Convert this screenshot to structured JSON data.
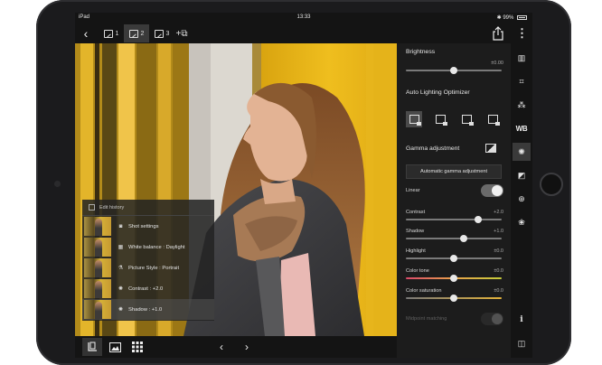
{
  "status": {
    "device": "iPad",
    "time": "13:33",
    "battery": "99%"
  },
  "tabs": [
    {
      "label": "1"
    },
    {
      "label": "2"
    },
    {
      "label": "3"
    }
  ],
  "history": {
    "title": "Edit history",
    "items": [
      {
        "label": "Shot settings",
        "icon": "camera-icon"
      },
      {
        "label": "White balance : Daylight",
        "icon": "white-balance-icon"
      },
      {
        "label": "Picture Style : Portrait",
        "icon": "picture-style-icon"
      },
      {
        "label": "Contrast : +2.0",
        "icon": "contrast-icon"
      },
      {
        "label": "Shadow : +1.0",
        "icon": "shadow-icon"
      }
    ]
  },
  "panel": {
    "brightness": {
      "title": "Brightness",
      "value": "±0.00",
      "level": 0.5
    },
    "alo": {
      "title": "Auto Lighting Optimizer",
      "selected": 0
    },
    "gamma": {
      "title": "Gamma adjustment",
      "button": "Automatic gamma adjustment"
    },
    "linear": {
      "label": "Linear",
      "on": true
    },
    "sliders": [
      {
        "key": "contrast",
        "label": "Contrast",
        "value": "+2.0",
        "level": 0.75
      },
      {
        "key": "shadow",
        "label": "Shadow",
        "value": "+1.0",
        "level": 0.6
      },
      {
        "key": "highlight",
        "label": "Highlight",
        "value": "±0.0",
        "level": 0.5
      },
      {
        "key": "color-tone",
        "label": "Color tone",
        "value": "±0.0",
        "level": 0.5
      },
      {
        "key": "color-saturation",
        "label": "Color saturation",
        "value": "±0.0",
        "level": 0.5
      }
    ],
    "midpoint": {
      "label": "Midpoint matching",
      "on": false
    }
  },
  "rail": {
    "items": [
      "histogram-icon",
      "crop-icon",
      "dust-delete-icon",
      "white-balance-icon",
      "brightness-icon",
      "tone-curve-icon",
      "lens-correction-icon",
      "color-adjust-icon"
    ],
    "active": "brightness-icon",
    "wb_label": "WB"
  },
  "colors": {
    "accent": "#f2c230",
    "photo_wall": "#e8b418"
  }
}
